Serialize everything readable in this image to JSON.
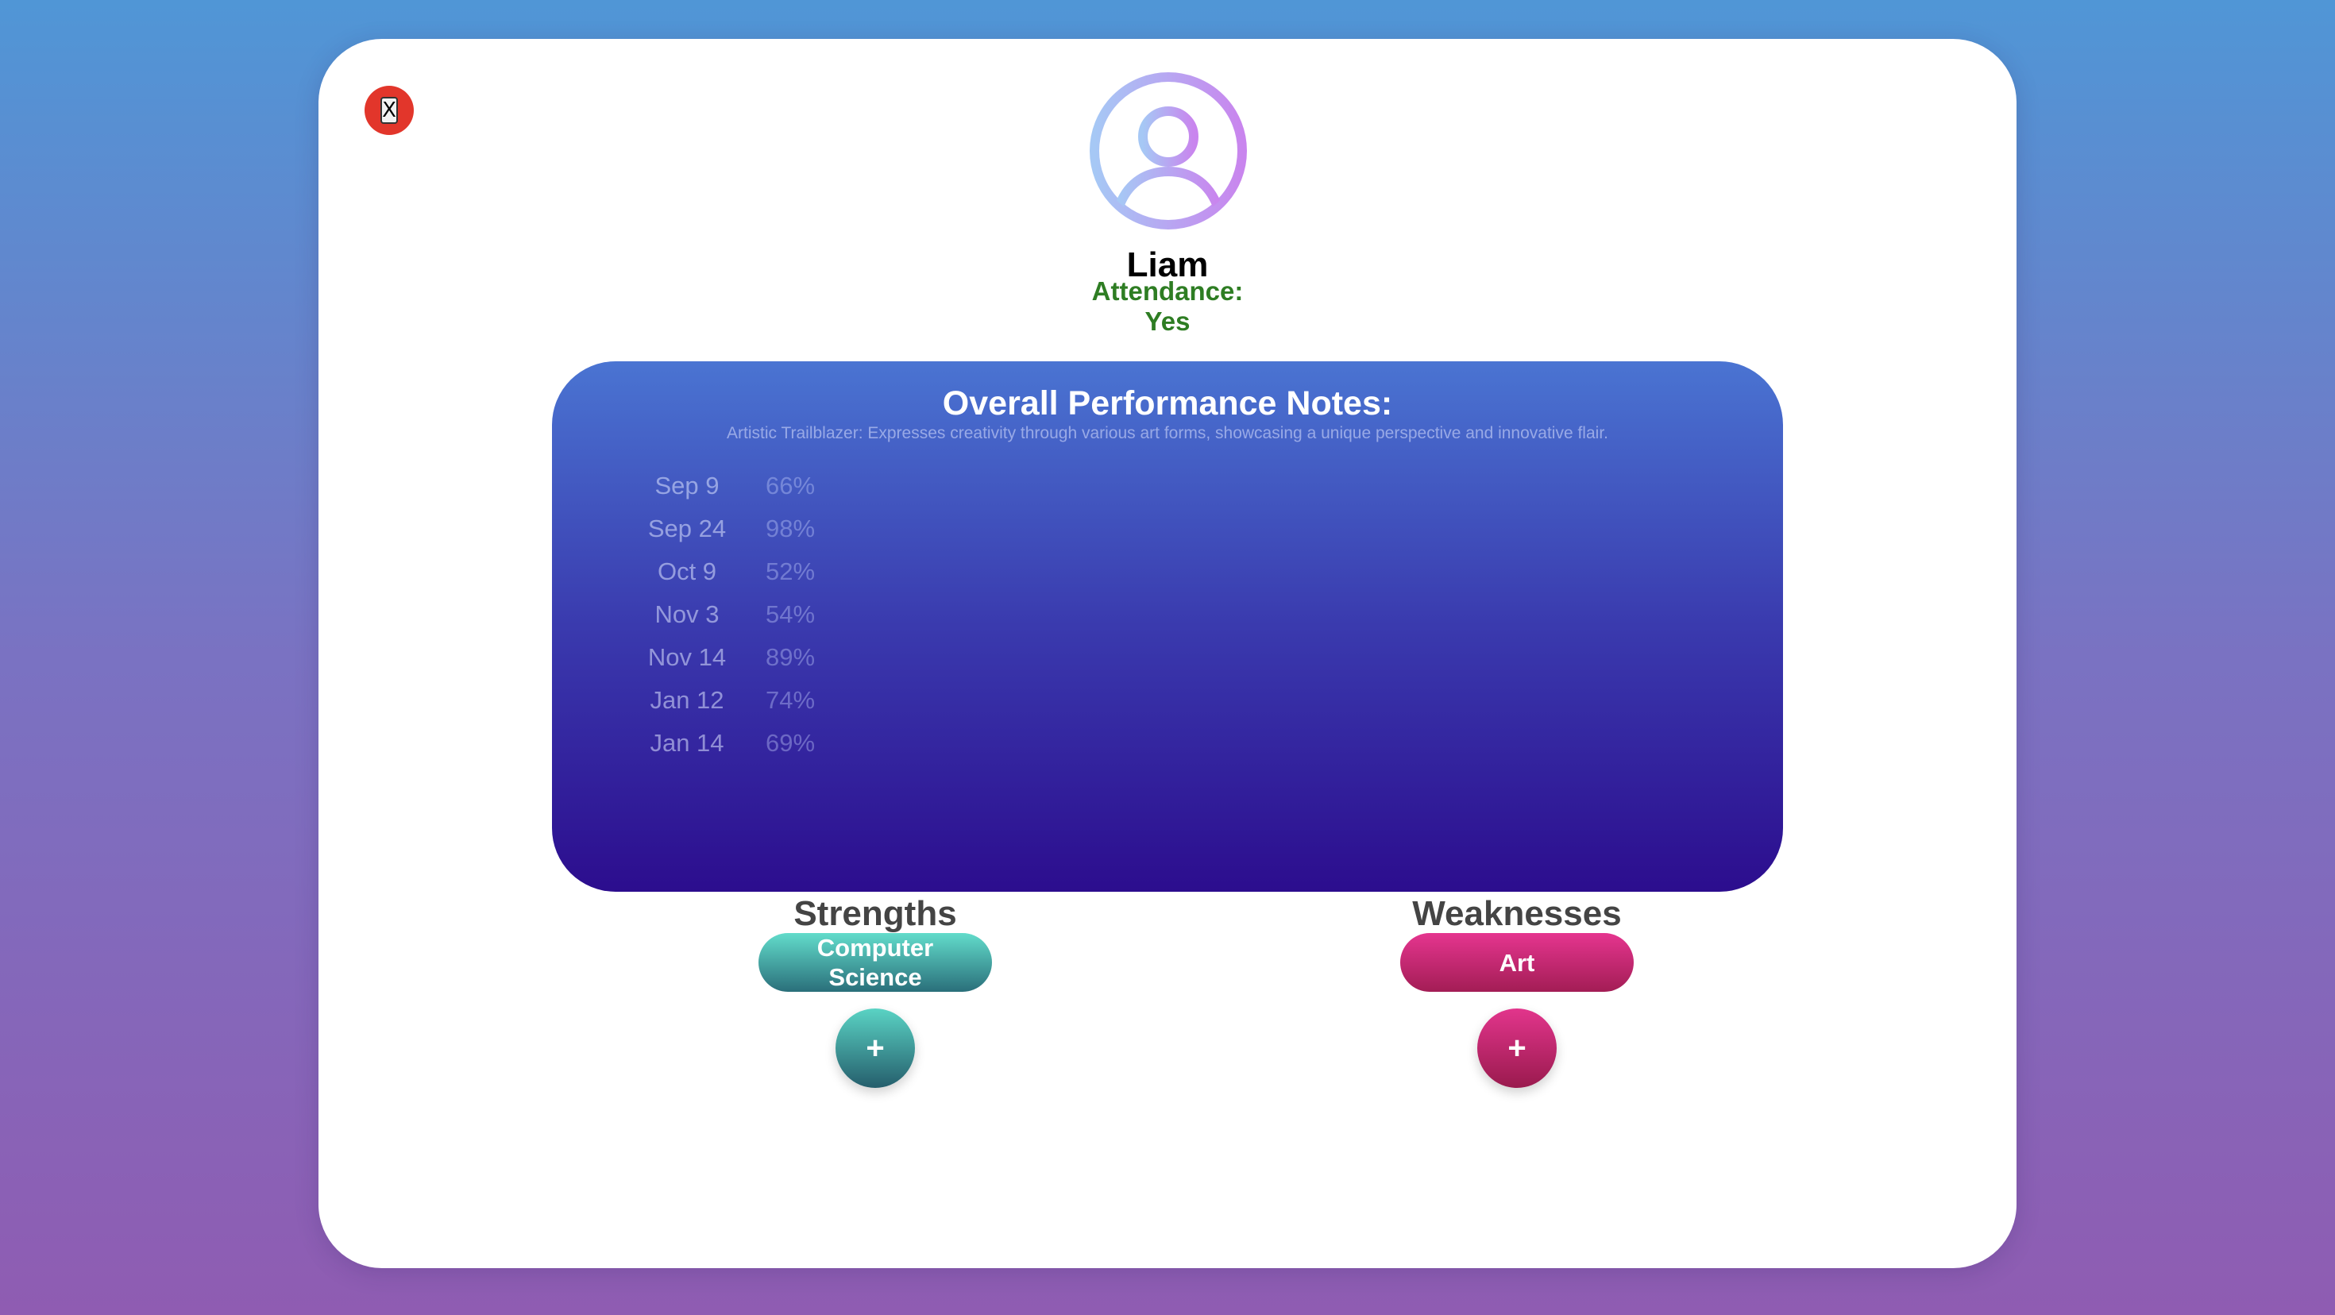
{
  "close_button": {
    "label": "X",
    "color": "#e2362b"
  },
  "profile": {
    "icon": "user-circle-icon",
    "name": "Liam",
    "attendance_label": "Attendance:",
    "attendance_value": "Yes"
  },
  "performance": {
    "title": "Overall Performance Notes:",
    "notes": "Artistic Trailblazer: Expresses creativity through various art forms, showcasing a unique perspective and innovative flair.",
    "records": [
      {
        "date": "Sep 9",
        "score": "66%"
      },
      {
        "date": "Sep 24",
        "score": "98%"
      },
      {
        "date": "Oct 9",
        "score": "52%"
      },
      {
        "date": "Nov 3",
        "score": "54%"
      },
      {
        "date": "Nov 14",
        "score": "89%"
      },
      {
        "date": "Jan 12",
        "score": "74%"
      },
      {
        "date": "Jan 14",
        "score": "69%"
      }
    ]
  },
  "strengths": {
    "title": "Strengths",
    "items": [
      "Computer Science"
    ],
    "add_label": "+"
  },
  "weaknesses": {
    "title": "Weaknesses",
    "items": [
      "Art"
    ],
    "add_label": "+"
  },
  "colors": {
    "background_top": "#5096d6",
    "background_bottom": "#8f5cb2",
    "attendance": "#2e7d23",
    "strength_accent": "#62dccb",
    "weakness_accent": "#e5358f",
    "panel_top": "#4a74d2",
    "panel_bottom": "#2c0d8e"
  }
}
